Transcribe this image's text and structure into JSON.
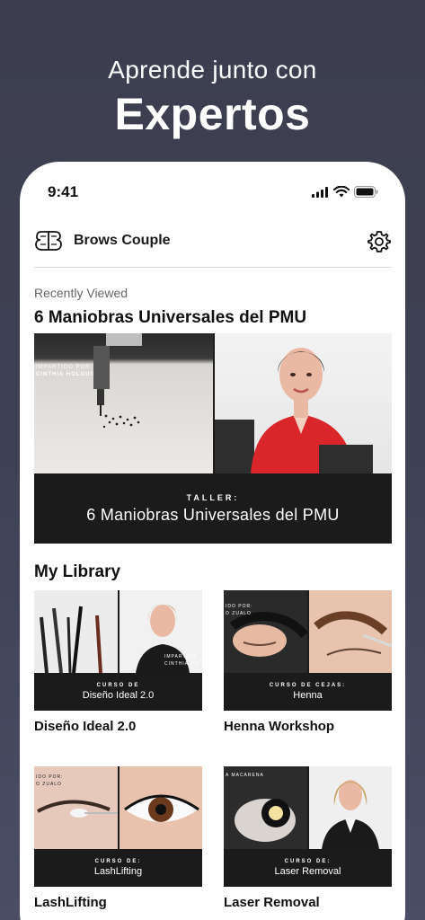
{
  "hero": {
    "subtitle": "Aprende junto con",
    "title": "Expertos"
  },
  "status_bar": {
    "time": "9:41",
    "icons": [
      "signal-icon",
      "wifi-icon",
      "battery-icon"
    ]
  },
  "header": {
    "app_name": "Brows Couple",
    "logo_icon": "bb-logo-icon",
    "settings_icon": "gear-icon"
  },
  "recent": {
    "section_label": "Recently Viewed",
    "title": "6 Maniobras Universales del PMU",
    "card": {
      "caption_line1": "IMPARTIDO POR:",
      "caption_line2": "CINTHIA HOLGUIN",
      "kicker": "TALLER:",
      "band_title": "6 Maniobras Universales del PMU"
    }
  },
  "library": {
    "title": "My Library",
    "items": [
      {
        "name": "Diseño Ideal 2.0",
        "kicker": "CURSO DE",
        "band_title": "Diseño Ideal 2.0",
        "caption": "IMPARTIDO\nCINTHIA HO"
      },
      {
        "name": "Henna Workshop",
        "kicker": "CURSO DE CEJAS:",
        "band_title": "Henna",
        "caption": "IDO POR:\nO ZUALO"
      },
      {
        "name": "LashLifting",
        "kicker": "CURSO DE:",
        "band_title": "LashLifting",
        "caption": "IDO POR:\nO ZUALO"
      },
      {
        "name": "Laser Removal",
        "kicker": "CURSO DE:",
        "band_title": "Laser Removal",
        "caption": "A MACARENA"
      }
    ]
  },
  "colors": {
    "background": "#3f4255",
    "card_band": "#1b1b1b",
    "accent_red": "#d8262a"
  }
}
